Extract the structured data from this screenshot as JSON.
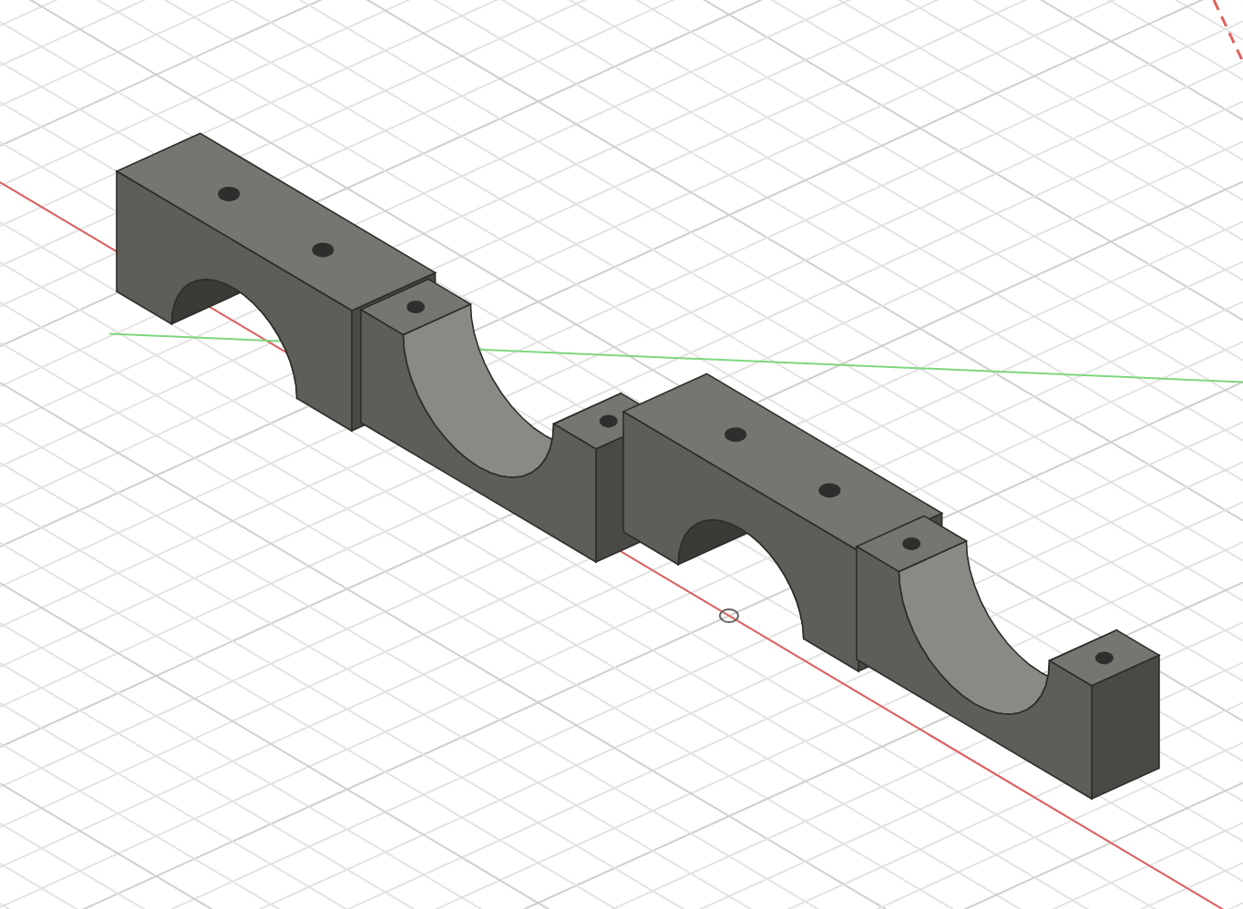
{
  "viewport": {
    "parts": [
      {
        "kind": "arch-clamp"
      },
      {
        "kind": "half-clamp"
      },
      {
        "kind": "arch-clamp"
      },
      {
        "kind": "half-clamp"
      }
    ]
  }
}
